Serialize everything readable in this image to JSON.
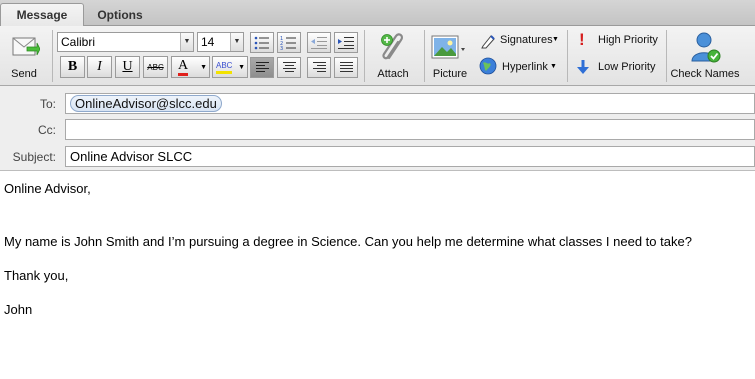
{
  "tabs": [
    {
      "label": "Message",
      "active": true
    },
    {
      "label": "Options",
      "active": false
    }
  ],
  "ribbon": {
    "send_label": "Send",
    "font_name": "Calibri",
    "font_size": "14",
    "attach_label": "Attach",
    "picture_label": "Picture",
    "signatures_label": "Signatures",
    "hyperlink_label": "Hyperlink",
    "high_priority_label": "High Priority",
    "low_priority_label": "Low Priority",
    "check_names_label": "Check Names",
    "bold": "B",
    "italic": "I",
    "underline": "U",
    "strike": "ABC",
    "font_color": "A",
    "highlight": "ABC"
  },
  "header": {
    "to_label": "To:",
    "to_recipient": "OnlineAdvisor@slcc.edu",
    "cc_label": "Cc:",
    "cc_value": "",
    "subject_label": "Subject:",
    "subject_value": "Online Advisor SLCC"
  },
  "body": {
    "greeting": "Online Advisor,",
    "paragraph": "My name is John Smith and I’m pursuing a degree in Science. Can you help me determine what classes I need to take?",
    "closing": "Thank you,",
    "signature": "John"
  },
  "colors": {
    "priority_high": "#d61f1f",
    "priority_low": "#2f6fd6",
    "font_color_bar": "#e0201b",
    "highlight_bar": "#f2e200",
    "chip_border": "#8fa9cc"
  }
}
